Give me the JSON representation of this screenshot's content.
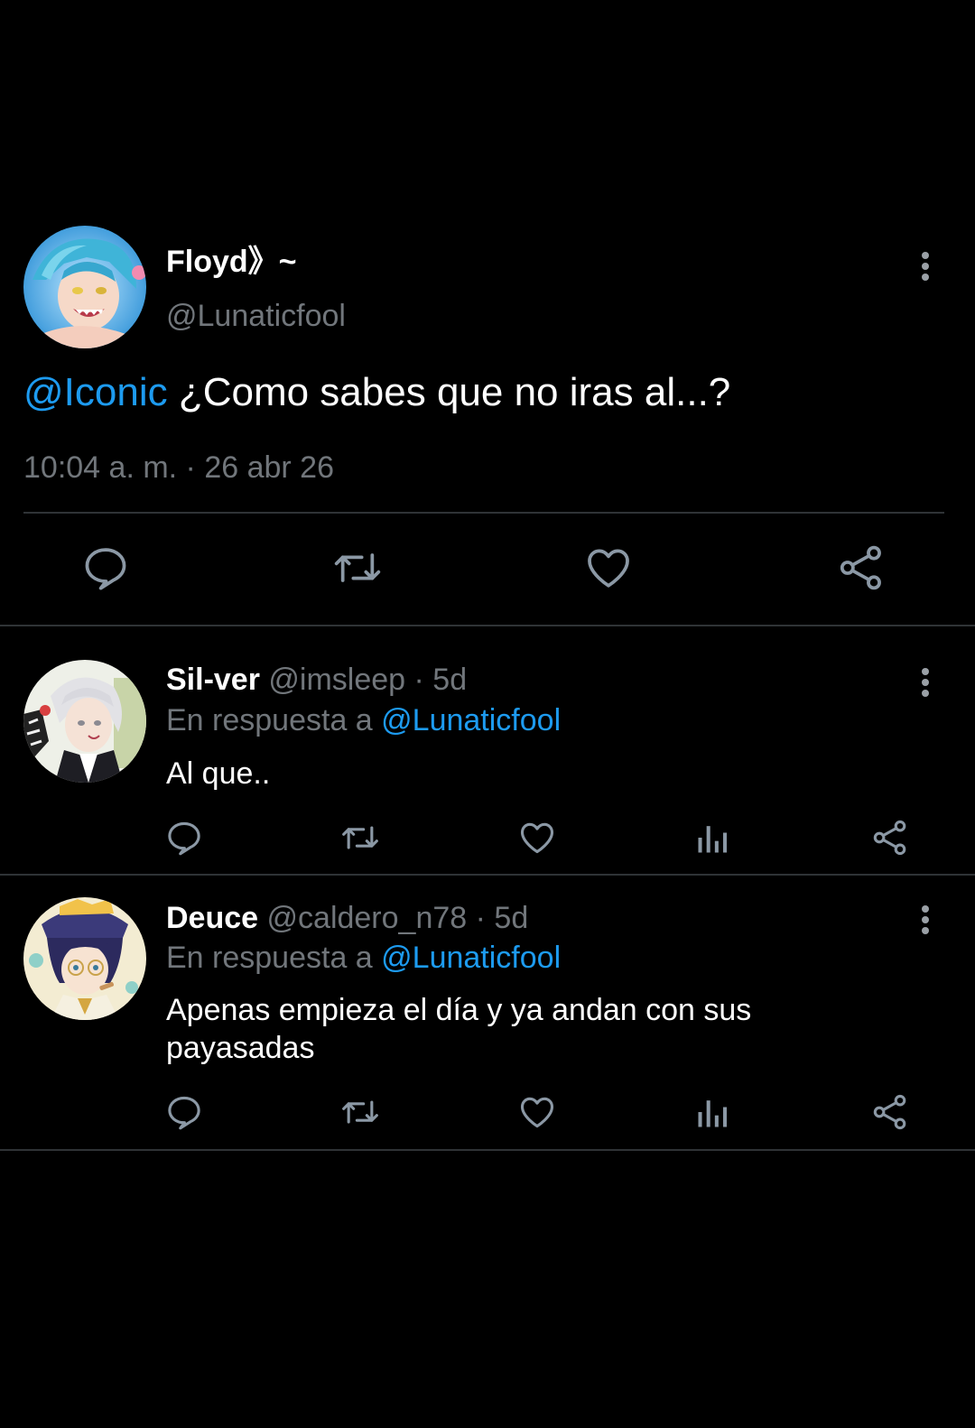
{
  "main_tweet": {
    "display_name": "Floyd》~",
    "handle": "@Lunaticfool",
    "mention": "@Iconic",
    "text": " ¿Como sabes que no iras al...?",
    "timestamp": "10:04 a. m. · 26 abr 26",
    "avatar": "avatar-floyd",
    "actions": [
      "reply-icon",
      "retweet-icon",
      "like-icon",
      "share-icon"
    ]
  },
  "replies": [
    {
      "display_name": "Sil-ver",
      "handle": "@imsleep",
      "age": "· 5d",
      "reply_prefix": "En respuesta a",
      "reply_to": "@Lunaticfool",
      "text": "Al que..",
      "avatar": "avatar-silver",
      "actions": [
        "reply-icon",
        "retweet-icon",
        "like-icon",
        "views-icon",
        "share-icon"
      ]
    },
    {
      "display_name": "Deuce",
      "handle": "@caldero_n78",
      "age": "· 5d",
      "reply_prefix": "En respuesta a",
      "reply_to": "@Lunaticfool",
      "text": "Apenas empieza el día y ya andan con sus payasadas",
      "avatar": "avatar-deuce",
      "actions": [
        "reply-icon",
        "retweet-icon",
        "like-icon",
        "views-icon",
        "share-icon"
      ]
    }
  ],
  "colors": {
    "background": "#000000",
    "accent": "#1d9bf0",
    "muted": "#71767b",
    "divider": "#2f3336",
    "icon": "#8b98a5"
  }
}
